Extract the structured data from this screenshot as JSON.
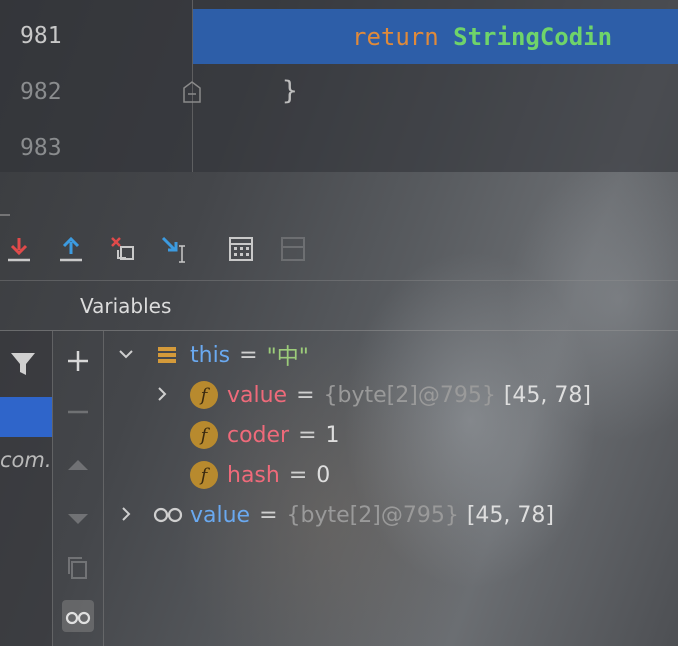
{
  "editor": {
    "lines": [
      {
        "number": "981",
        "code_keyword": "return",
        "code_rest": "StringCodin"
      },
      {
        "number": "982",
        "code": "}"
      },
      {
        "number": "983",
        "code": ""
      }
    ]
  },
  "debug_toolbar": {
    "icons": [
      "step-into-icon",
      "step-out-icon",
      "drop-frame-icon",
      "run-to-cursor-icon",
      "evaluate-expression-icon"
    ]
  },
  "variables_panel": {
    "tab_label": "Variables",
    "frame_text": "com.",
    "tree": [
      {
        "icon": "object-stack-icon",
        "name": "this",
        "eq": "=",
        "value": "\"中\"",
        "expanded": true,
        "children": [
          {
            "icon": "field-icon",
            "badge": "f",
            "name": "value",
            "eq": "=",
            "type": "{byte[2]@795}",
            "value": "[45, 78]",
            "expandable": true
          },
          {
            "icon": "field-icon",
            "badge": "f",
            "name": "coder",
            "eq": "=",
            "value": "1"
          },
          {
            "icon": "field-icon",
            "badge": "f",
            "name": "hash",
            "eq": "=",
            "value": "0"
          }
        ]
      },
      {
        "icon": "watch-glasses-icon",
        "name": "value",
        "eq": "=",
        "type": "{byte[2]@795}",
        "value": "[45, 78]",
        "expandable": true
      }
    ]
  }
}
